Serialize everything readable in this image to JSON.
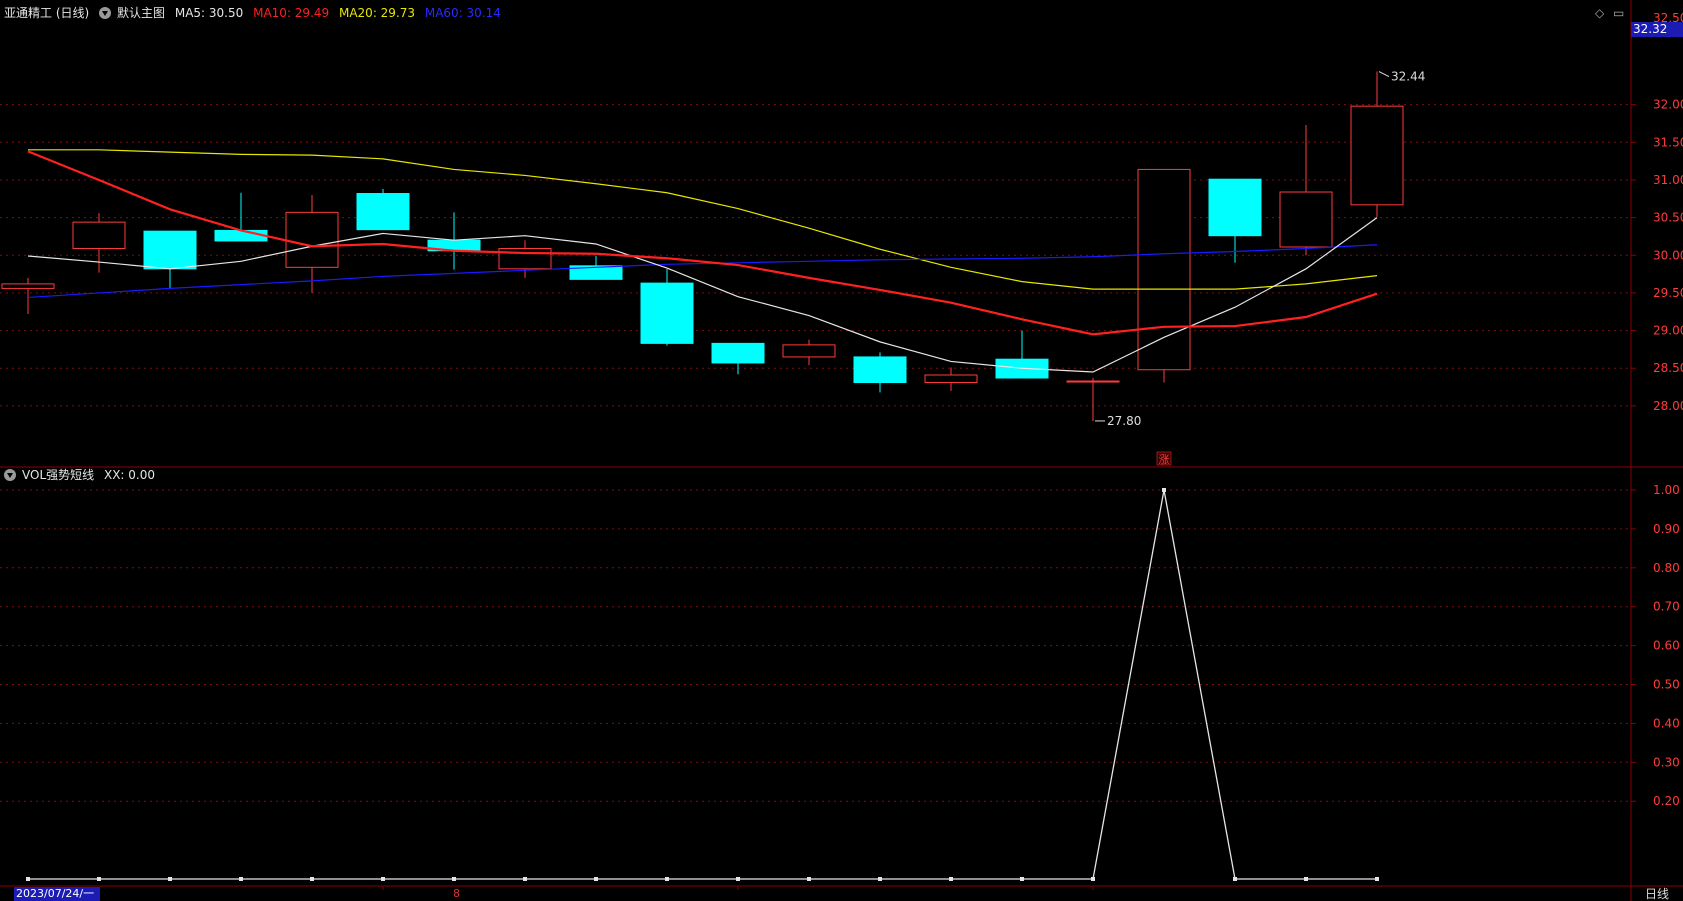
{
  "header": {
    "stock_name": "亚通精工 (日线)",
    "template_label": "默认主图",
    "ma5": "MA5: 30.50",
    "ma10": "MA10: 29.49",
    "ma20": "MA20: 29.73",
    "ma60": "MA60: 30.14"
  },
  "indicator_header": {
    "label": "VOL强势短线",
    "value": "XX: 0.00"
  },
  "controls": {
    "diamond_glyph": "◇",
    "square_glyph": "▭"
  },
  "price_badge": "32.32",
  "high_label": "32.44",
  "low_label": "27.80",
  "marker_label": "涨",
  "date_label": "2023/07/24/一",
  "month_label": "8",
  "period_label": "日线",
  "colors": {
    "up": "#ff3b3b",
    "down": "#00ffff",
    "ma5": "#e6e6e6",
    "ma10": "#ff2020",
    "ma20": "#e6e600",
    "ma60": "#1a1aff",
    "axis": "#8b0000",
    "grid": "#7a1010",
    "badge_bg": "#1c1cb4"
  },
  "chart_data": [
    {
      "type": "candlestick",
      "title": "亚通精工 (日线)",
      "y_ticks": [
        "28.00",
        "28.50",
        "29.00",
        "29.50",
        "30.00",
        "30.50",
        "31.00",
        "31.50",
        "32.00"
      ],
      "ylim": [
        27.6,
        32.5
      ],
      "candles": [
        {
          "o": 29.56,
          "c": 29.62,
          "h": 29.7,
          "l": 29.22
        },
        {
          "o": 30.09,
          "c": 30.44,
          "h": 30.56,
          "l": 29.77
        },
        {
          "o": 30.32,
          "c": 29.82,
          "h": 30.32,
          "l": 29.56
        },
        {
          "o": 30.33,
          "c": 30.19,
          "h": 30.83,
          "l": 30.19
        },
        {
          "o": 29.84,
          "c": 30.57,
          "h": 30.8,
          "l": 29.5
        },
        {
          "o": 30.82,
          "c": 30.34,
          "h": 30.88,
          "l": 30.34
        },
        {
          "o": 30.2,
          "c": 30.06,
          "h": 30.57,
          "l": 29.81
        },
        {
          "o": 29.82,
          "c": 30.09,
          "h": 30.2,
          "l": 29.7
        },
        {
          "o": 29.86,
          "c": 29.68,
          "h": 29.99,
          "l": 29.68
        },
        {
          "o": 29.63,
          "c": 28.83,
          "h": 29.82,
          "l": 28.8
        },
        {
          "o": 28.83,
          "c": 28.57,
          "h": 28.83,
          "l": 28.42
        },
        {
          "o": 28.65,
          "c": 28.81,
          "h": 28.88,
          "l": 28.54
        },
        {
          "o": 28.65,
          "c": 28.31,
          "h": 28.71,
          "l": 28.18
        },
        {
          "o": 28.31,
          "c": 28.41,
          "h": 28.51,
          "l": 28.2
        },
        {
          "o": 28.62,
          "c": 28.37,
          "h": 29.0,
          "l": 28.37
        },
        {
          "o": 28.33,
          "c": 28.33,
          "h": 28.37,
          "l": 27.8
        },
        {
          "o": 28.48,
          "c": 31.14,
          "h": 31.14,
          "l": 28.31
        },
        {
          "o": 31.01,
          "c": 30.26,
          "h": 31.01,
          "l": 29.9
        },
        {
          "o": 30.11,
          "c": 30.84,
          "h": 31.73,
          "l": 30.0
        },
        {
          "o": 30.67,
          "c": 31.98,
          "h": 32.44,
          "l": 30.51
        }
      ],
      "ma5": [
        29.99,
        29.91,
        29.82,
        29.92,
        30.12,
        30.29,
        30.2,
        30.26,
        30.15,
        29.83,
        29.45,
        29.2,
        28.85,
        28.59,
        28.5,
        28.45,
        28.91,
        29.31,
        29.82,
        30.5
      ],
      "ma10": [
        31.38,
        31.0,
        30.61,
        30.33,
        30.12,
        30.15,
        30.06,
        30.03,
        30.02,
        29.96,
        29.87,
        29.7,
        29.54,
        29.37,
        29.15,
        28.95,
        29.05,
        29.06,
        29.18,
        29.49
      ],
      "ma20": [
        31.4,
        31.4,
        31.37,
        31.34,
        31.33,
        31.28,
        31.14,
        31.06,
        30.95,
        30.83,
        30.62,
        30.36,
        30.08,
        29.84,
        29.65,
        29.55,
        29.55,
        29.55,
        29.62,
        29.73
      ],
      "ma60": [
        29.44,
        29.5,
        29.56,
        29.61,
        29.66,
        29.72,
        29.76,
        29.8,
        29.84,
        29.88,
        29.9,
        29.92,
        29.94,
        29.95,
        29.96,
        29.98,
        30.02,
        30.05,
        30.09,
        30.14
      ]
    },
    {
      "type": "line",
      "title": "VOL强势短线",
      "y_ticks": [
        "0.20",
        "0.30",
        "0.40",
        "0.50",
        "0.60",
        "0.70",
        "0.80",
        "0.90",
        "1.00"
      ],
      "ylim": [
        0,
        1.02
      ],
      "series": [
        {
          "name": "XX",
          "values": [
            0,
            0,
            0,
            0,
            0,
            0,
            0,
            0,
            0,
            0,
            0,
            0,
            0,
            0,
            0,
            0,
            1,
            0,
            0,
            0
          ]
        }
      ]
    }
  ]
}
